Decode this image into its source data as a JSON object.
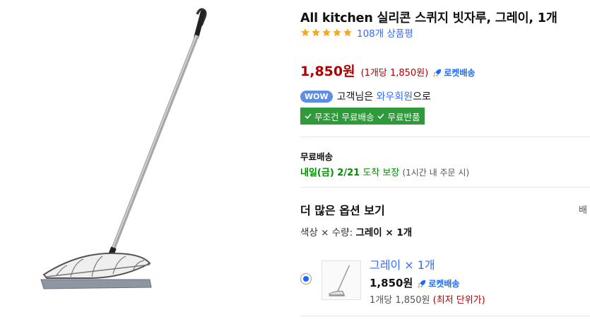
{
  "product": {
    "title": "All kitchen 실리콘 스퀴지 빗자루, 그레이, 1개",
    "rating_stars": 5,
    "review_count": "108개 상품평"
  },
  "price": {
    "main": "1,850원",
    "unit": "(1개당 1,850원)",
    "rocket_label": "로켓배송"
  },
  "wow": {
    "badge": "WOW",
    "text_prefix": "고객님은",
    "link": "와우회원",
    "text_suffix": "으로",
    "free_shipping": "무조건 무료배송",
    "free_return": "무료반품"
  },
  "shipping": {
    "title": "무료배송",
    "date": "내일(금) 2/21",
    "guarantee": "도착 보장",
    "note": "(1시간 내 주문 시)"
  },
  "options": {
    "title": "더 많은 옵션 보기",
    "right_text": "배",
    "spec_color_label": "색상",
    "spec_qty_label": "수량:",
    "spec_value": "그레이 × 1개",
    "item": {
      "name": "그레이 × 1개",
      "price": "1,850원",
      "rocket_label": "로켓배송",
      "unit_price": "1개당 1,850원",
      "lowest": "(최저 단위가)",
      "selected": true
    }
  },
  "colors": {
    "price_red": "#ae0000",
    "link_blue": "#346aff",
    "rocket_blue": "#1b6aff",
    "badge_green": "#2f9a3a",
    "star_orange": "#f5a623"
  }
}
